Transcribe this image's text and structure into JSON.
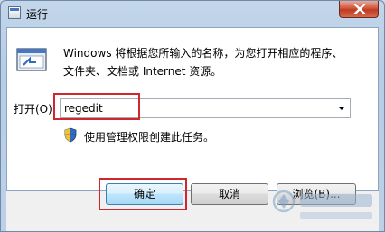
{
  "window": {
    "title": "运行"
  },
  "dialog": {
    "description_line1": "Windows 将根据您所输入的名称，为您打开相应的程序、",
    "description_line2": "文件夹、文档或 Internet 资源。",
    "open_label": "打开(O):",
    "command_value": "regedit",
    "admin_note": "使用管理权限创建此任务。"
  },
  "buttons": {
    "ok": "确定",
    "cancel": "取消",
    "browse": "浏览(B)..."
  },
  "colors": {
    "highlight": "#d0262e",
    "accent": "#3c7fb1"
  },
  "icons": [
    "run-dialog-icon",
    "close-icon",
    "chevron-down-icon",
    "uac-shield-icon",
    "watermark-logo"
  ]
}
